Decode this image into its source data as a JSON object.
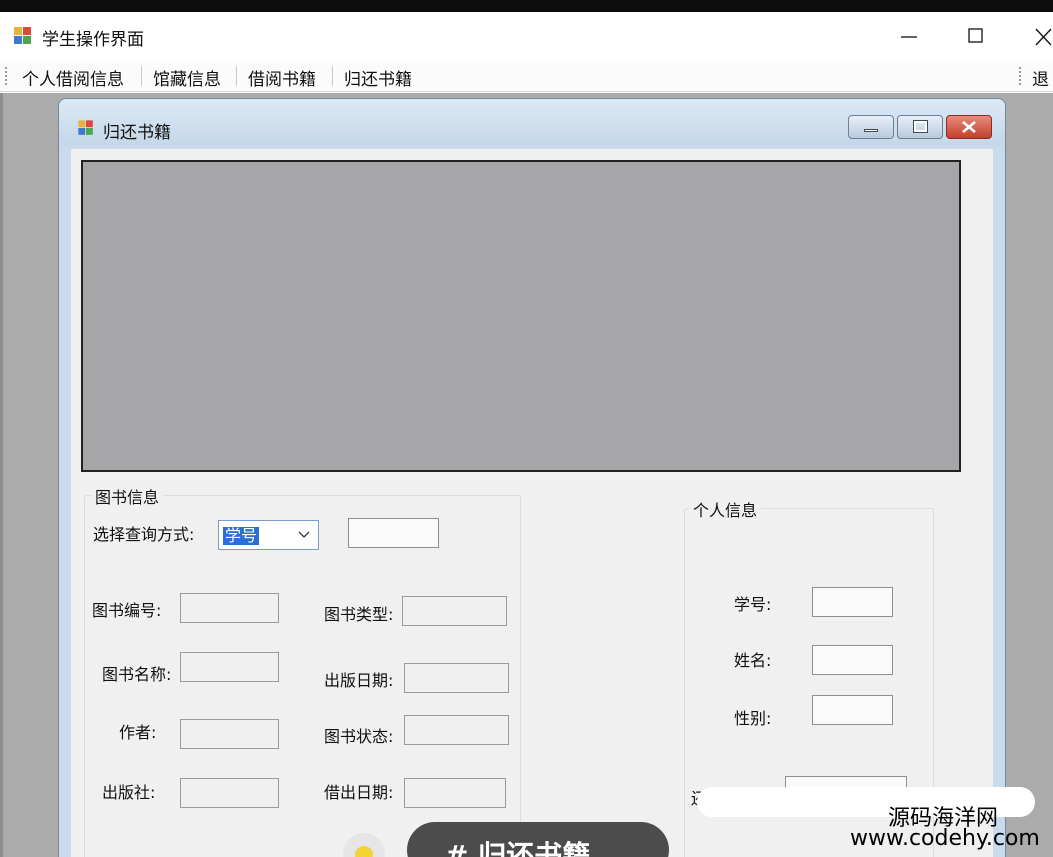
{
  "window": {
    "title": "学生操作界面",
    "icon": "app-icon",
    "controls": [
      "minimize-icon",
      "maximize-icon",
      "close-icon"
    ]
  },
  "menu": {
    "items": [
      "个人借阅信息",
      "馆藏信息",
      "借阅书籍",
      "归还书籍"
    ],
    "exit_label": "退出"
  },
  "child": {
    "title": "归还书籍",
    "book_group": {
      "legend": "图书信息",
      "query_label": "选择查询方式:",
      "query_value": "学号",
      "fields": {
        "book_id": "图书编号:",
        "book_type": "图书类型:",
        "book_name": "图书名称:",
        "pub_date": "出版日期:",
        "author": "作者:",
        "book_status": "图书状态:",
        "publisher": "出版社:",
        "borrow_date": "借出日期:"
      }
    },
    "person_group": {
      "legend": "个人信息",
      "student_id": "学号:",
      "name": "姓名:",
      "gender": "性别:",
      "partial_label": "还"
    }
  },
  "overlay": {
    "site_name": "源码海洋网",
    "site_url": "www.codehy.com",
    "tag": "# 归还书籍"
  },
  "colors": {
    "mdi_background": "#ababab",
    "grid_background": "#a6a6a8",
    "child_frame": "#c9dbea",
    "selection": "#2a6fd6"
  }
}
